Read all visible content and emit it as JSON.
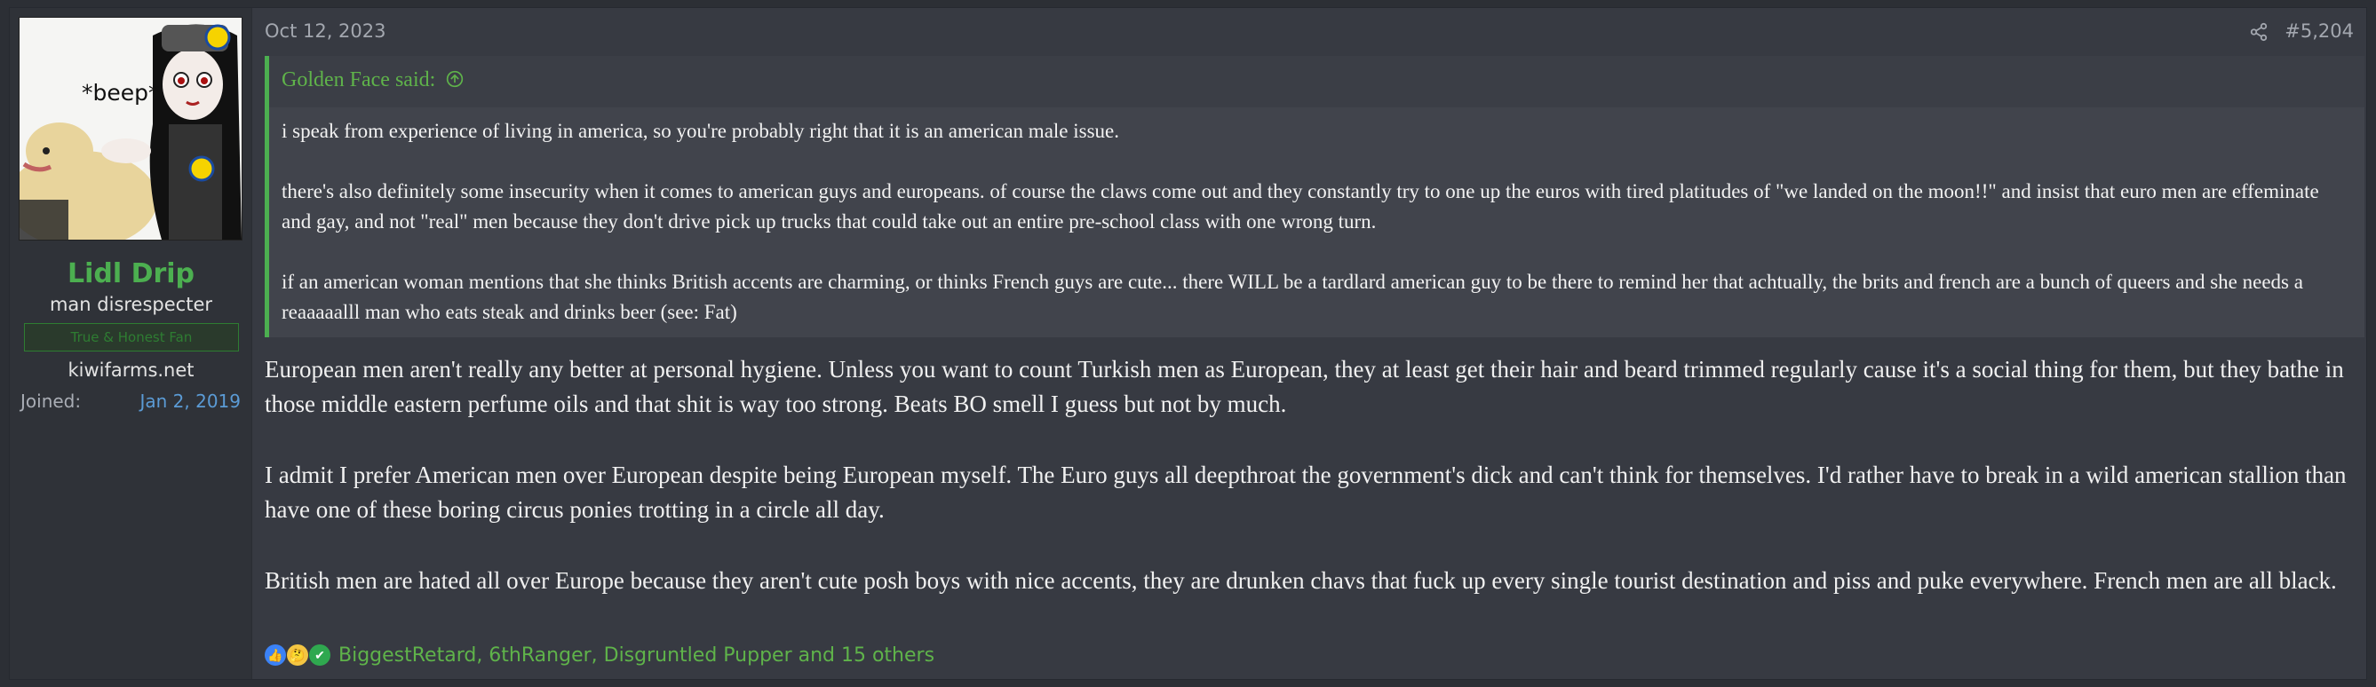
{
  "user": {
    "avatar_caption": "*beep*",
    "avatar_badge": "Lidl",
    "name": "Lidl Drip",
    "title": "man disrespecter",
    "banner": "True & Honest Fan",
    "website": "kiwifarms.net",
    "joined_label": "Joined:",
    "joined_date": "Jan 2, 2019"
  },
  "post": {
    "date": "Oct 12, 2023",
    "number": "#5,204",
    "quote": {
      "author": "Golden Face said:",
      "paragraphs": [
        "i speak from experience of living in america, so you're probably right that it is an american male issue.",
        "there's also definitely some insecurity when it comes to american guys and europeans. of course the claws come out and they constantly try to one up the euros with tired platitudes of \"we landed on the moon!!\" and insist that euro men are effeminate and gay, and not \"real\" men because they don't drive pick up trucks that could take out an entire pre-school class with one wrong turn.",
        "if an american woman mentions that she thinks British accents are charming, or thinks French guys are cute... there WILL be a tardlard american guy to be there to remind her that achtually, the brits and french are a bunch of queers and she needs a reaaaaalll man who eats steak and drinks beer (see: Fat)"
      ]
    },
    "body": [
      "European men aren't really any better at personal hygiene. Unless you want to count Turkish men as European, they at least get their hair and beard trimmed regularly cause it's a social thing for them, but they bathe in those middle eastern perfume oils and that shit is way too strong. Beats BO smell I guess but not by much.",
      "I admit I prefer American men over European despite being European myself. The Euro guys all deepthroat the government's dick and can't think for themselves. I'd rather have to break in a wild american stallion than have one of these boring circus ponies trotting in a circle all day.",
      "British men are hated all over Europe because they aren't cute posh boys with nice accents, they are drunken chavs that fuck up every single tourist destination and piss and puke everywhere. French men are all black."
    ],
    "reactions": {
      "icons": [
        "like-icon",
        "thinking-icon",
        "agree-icon"
      ],
      "text": "BiggestRetard, 6thRanger, Disgruntled Pupper and 15 others"
    }
  },
  "colors": {
    "accent_green": "#4caf50",
    "link_blue": "#5b9bd5",
    "background": "#373a42"
  }
}
